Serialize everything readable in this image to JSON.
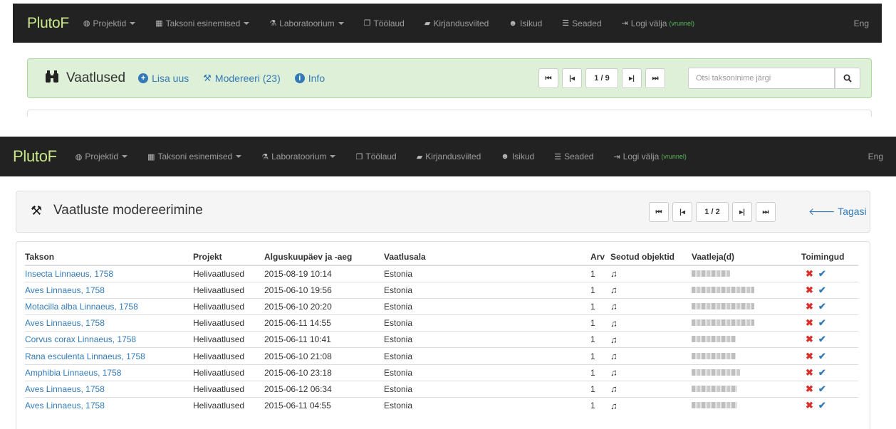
{
  "navbar": {
    "brand": "PlutoF",
    "items": [
      {
        "label": "Projektid",
        "icon": "globe-icon",
        "dropdown": true
      },
      {
        "label": "Taksoni esinemised",
        "icon": "grid-icon",
        "dropdown": true
      },
      {
        "label": "Laboratoorium",
        "icon": "flask-icon",
        "dropdown": true
      },
      {
        "label": "Töölaud",
        "icon": "copy-icon",
        "dropdown": false
      },
      {
        "label": "Kirjandusviited",
        "icon": "book-icon",
        "dropdown": false
      },
      {
        "label": "Isikud",
        "icon": "users-icon",
        "dropdown": false
      },
      {
        "label": "Seaded",
        "icon": "sliders-icon",
        "dropdown": false
      }
    ],
    "logout_label": "Logi välja",
    "logout_user": "(vrunnel)",
    "lang": "Eng"
  },
  "observations": {
    "title": "Vaatlused",
    "add_label": "Lisa uus",
    "moderate_label": "Modereeri (23)",
    "info_label": "Info",
    "page": "1 / 9",
    "search_placeholder": "Otsi taksoninimе järgi"
  },
  "moderation": {
    "title": "Vaatluste modereerimine",
    "page": "1 / 2",
    "back_label": "Tagasi"
  },
  "table": {
    "headers": [
      "Takson",
      "Projekt",
      "Alguskuupäev ja -aeg",
      "Vaatlusala",
      "Arv",
      "Seotud objektid",
      "Vaatleja(d)",
      "Toimingud"
    ],
    "rows": [
      {
        "taxon": "Insecta Linnaeus, 1758",
        "project": "Helivaatlused",
        "date": "2015-08-19 10:14",
        "area": "Estonia",
        "count": "1",
        "note": "♫"
      },
      {
        "taxon": "Aves Linnaeus, 1758",
        "project": "Helivaatlused",
        "date": "2015-06-10 19:56",
        "area": "Estonia",
        "count": "1",
        "note": "♫"
      },
      {
        "taxon": "Motacilla alba Linnaeus, 1758",
        "project": "Helivaatlused",
        "date": "2015-06-10 20:20",
        "area": "Estonia",
        "count": "1",
        "note": "♫"
      },
      {
        "taxon": "Aves Linnaeus, 1758",
        "project": "Helivaatlused",
        "date": "2015-06-11 14:55",
        "area": "Estonia",
        "count": "1",
        "note": "♫"
      },
      {
        "taxon": "Corvus corax Linnaeus, 1758",
        "project": "Helivaatlused",
        "date": "2015-06-11 10:41",
        "area": "Estonia",
        "count": "1",
        "note": "♫"
      },
      {
        "taxon": "Rana esculenta Linnaeus, 1758",
        "project": "Helivaatlused",
        "date": "2015-06-10 21:08",
        "area": "Estonia",
        "count": "1",
        "note": "♫"
      },
      {
        "taxon": "Amphibia Linnaeus, 1758",
        "project": "Helivaatlused",
        "date": "2015-06-10 23:18",
        "area": "Estonia",
        "count": "1",
        "note": "♫"
      },
      {
        "taxon": "Aves Linnaeus, 1758",
        "project": "Helivaatlused",
        "date": "2015-06-12 06:34",
        "area": "Estonia",
        "count": "1",
        "note": "♫"
      },
      {
        "taxon": "Aves Linnaeus, 1758",
        "project": "Helivaatlused",
        "date": "2015-06-11 04:55",
        "area": "Estonia",
        "count": "1",
        "note": "♫"
      }
    ],
    "reject_symbol": "✖",
    "accept_symbol": "✔"
  },
  "colors": {
    "navbar": "#222222",
    "brand": "#c9e78b",
    "link": "#337ab7",
    "success_bg": "#dff0d8",
    "reject": "#d9302c"
  }
}
